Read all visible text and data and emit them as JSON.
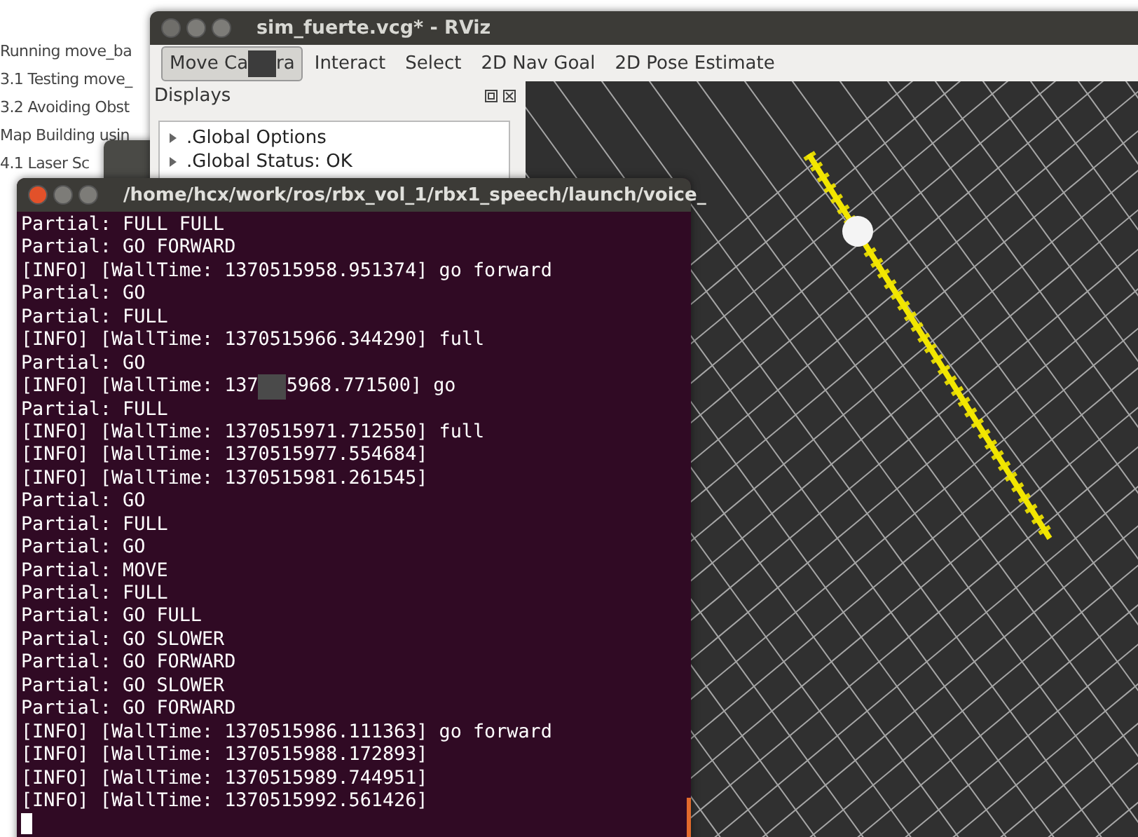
{
  "document": {
    "toc_items": [
      "Running move_ba",
      "3.1 Testing move_",
      "3.2 Avoiding Obst",
      "Map Building usin",
      "4.1 Laser Sc"
    ]
  },
  "rviz": {
    "title": "sim_fuerte.vcg* - RViz",
    "tools": [
      {
        "parts": [
          "Move Ca",
          "ra"
        ],
        "selected": true
      },
      {
        "parts": [
          "Interact"
        ],
        "selected": false
      },
      {
        "parts": [
          "Select"
        ],
        "selected": false
      },
      {
        "parts": [
          "2D Nav Goal"
        ],
        "selected": false
      },
      {
        "parts": [
          "2D Pose Estimate"
        ],
        "selected": false
      }
    ],
    "displays": {
      "title": "Displays",
      "items": [
        {
          "label": ".Global Options",
          "expanded": false
        },
        {
          "label": ".Global Status: OK",
          "expanded": false
        }
      ]
    }
  },
  "terminal": {
    "title": "/home/hcx/work/ros/rbx_vol_1/rbx1_speech/launch/voice_",
    "lines": [
      [
        "Partial: FULL FULL"
      ],
      [
        "Partial: GO FORWARD"
      ],
      [
        "[INFO] [WallTime: 1370515958.951374] go forward"
      ],
      [
        "Partial: GO"
      ],
      [
        "Partial: FULL"
      ],
      [
        "[INFO] [WallTime: 1370515966.344290] full"
      ],
      [
        "Partial: GO"
      ],
      [
        "[INFO] [WallTime: 137",
        "5968.771500] go"
      ],
      [
        "Partial: FULL"
      ],
      [
        "[INFO] [WallTime: 1370515971.712550] full"
      ],
      [
        "[INFO] [WallTime: 1370515977.554684]"
      ],
      [
        "[INFO] [WallTime: 1370515981.261545]"
      ],
      [
        "Partial: GO"
      ],
      [
        "Partial: FULL"
      ],
      [
        "Partial: GO"
      ],
      [
        "Partial: MOVE"
      ],
      [
        "Partial: FULL"
      ],
      [
        "Partial: GO FULL"
      ],
      [
        "Partial: GO SLOWER"
      ],
      [
        "Partial: GO FORWARD"
      ],
      [
        "Partial: GO SLOWER"
      ],
      [
        "Partial: GO FORWARD"
      ],
      [
        "[INFO] [WallTime: 1370515986.111363] go forward"
      ],
      [
        "[INFO] [WallTime: 1370515988.172893]"
      ],
      [
        "[INFO] [WallTime: 1370515989.744951]"
      ],
      [
        "[INFO] [WallTime: 1370515992.561426]"
      ]
    ]
  }
}
